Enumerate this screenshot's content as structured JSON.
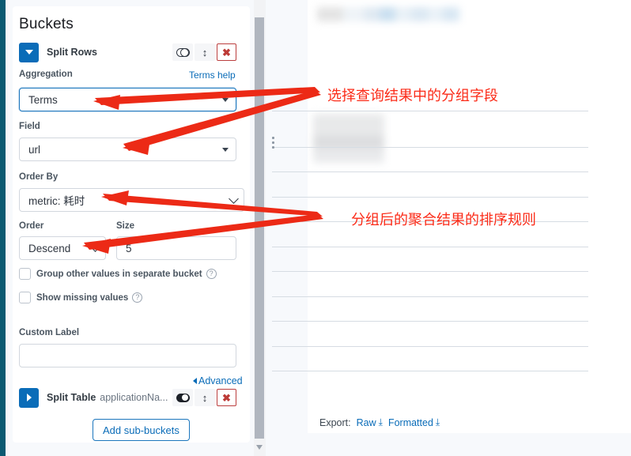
{
  "panel": {
    "title": "Buckets",
    "split_rows": {
      "label": "Split Rows",
      "toggle_icon": "toggle-off-icon",
      "move_icon": "move-vertical-icon",
      "remove_icon": "remove-x-icon"
    },
    "aggregation": {
      "label": "Aggregation",
      "help_link": "Terms help",
      "value": "Terms",
      "caret_icon": "caret-down-icon"
    },
    "field": {
      "label": "Field",
      "value": "url",
      "caret_icon": "caret-down-icon"
    },
    "order_by": {
      "label": "Order By",
      "value": "metric: 耗时",
      "caret_icon": "chevron-down-icon"
    },
    "order": {
      "label": "Order",
      "value": "Descend",
      "caret_icon": "chevron-down-icon"
    },
    "size": {
      "label": "Size",
      "value": "5"
    },
    "checkboxes": [
      {
        "label": "Group other values in separate bucket",
        "checked": false,
        "help_icon": "question-circle-icon"
      },
      {
        "label": "Show missing values",
        "checked": false,
        "help_icon": "question-circle-icon"
      }
    ],
    "custom_label": {
      "label": "Custom Label",
      "value": "",
      "placeholder": ""
    },
    "advanced": {
      "label": "Advanced",
      "caret_icon": "caret-left-icon"
    },
    "split_table": {
      "label": "Split Table",
      "sub_label": "applicationNa...",
      "toggle_icon": "toggle-on-icon",
      "move_icon": "move-vertical-icon",
      "remove_icon": "remove-x-icon"
    },
    "add_sub_buckets": "Add sub-buckets"
  },
  "results": {
    "export": {
      "label": "Export:",
      "raw": "Raw",
      "formatted": "Formatted",
      "download_icon": "download-icon"
    },
    "drag_handle_icon": "drag-dots-icon"
  },
  "annotations": [
    {
      "text": "选择查询结果中的分组字段",
      "color": "#fb2b18"
    },
    {
      "text": "分组后的聚合结果的排序规则",
      "color": "#fb2b18"
    }
  ],
  "colors": {
    "accent_blue": "#0a6cb8",
    "danger_red": "#bd3a36",
    "annotation_red": "#fb2b18",
    "rail_teal": "#0b5a72"
  }
}
